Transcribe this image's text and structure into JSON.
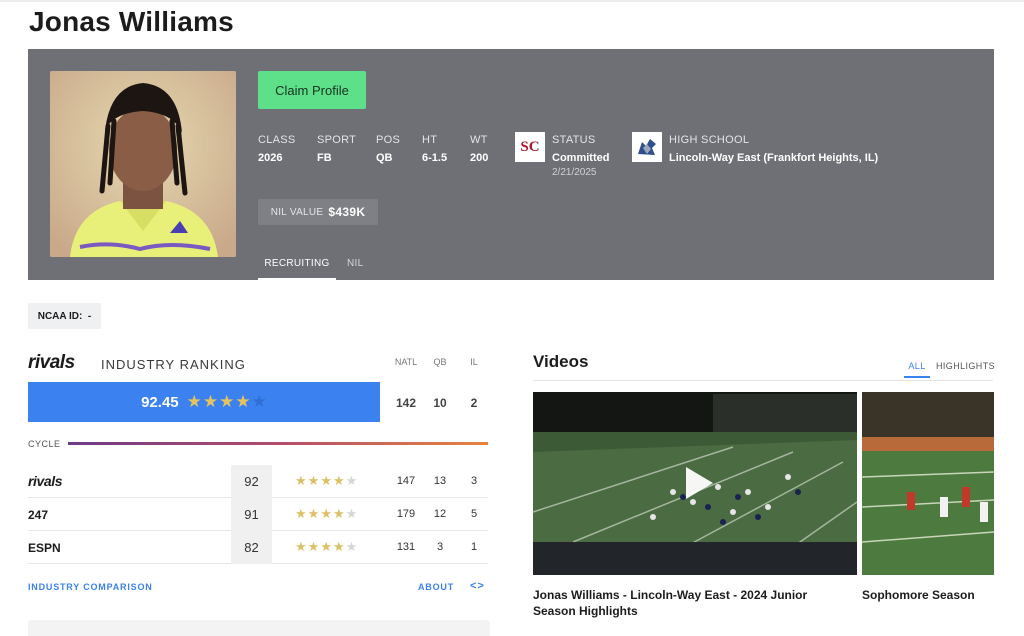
{
  "player": {
    "name": "Jonas Williams"
  },
  "profile": {
    "claim_label": "Claim Profile",
    "stats": [
      {
        "label": "CLASS",
        "value": "2026"
      },
      {
        "label": "SPORT",
        "value": "FB"
      },
      {
        "label": "POS",
        "value": "QB"
      },
      {
        "label": "HT",
        "value": "6-1.5"
      },
      {
        "label": "WT",
        "value": "200"
      }
    ],
    "status": {
      "label": "STATUS",
      "value": "Committed",
      "date": "2/21/2025",
      "logo_text": "SC"
    },
    "high_school": {
      "label": "HIGH SCHOOL",
      "value": "Lincoln-Way East (Frankfort Heights, IL)"
    },
    "nil": {
      "label": "NIL VALUE",
      "value": "$439K"
    },
    "tabs": [
      {
        "label": "RECRUITING"
      },
      {
        "label": "NIL"
      }
    ]
  },
  "ncaa": {
    "label": "NCAA ID:",
    "value": "-"
  },
  "ranking": {
    "brand": "rivals",
    "title": "INDUSTRY RANKING",
    "columns": [
      "NATL",
      "QB",
      "IL"
    ],
    "score": "92.45",
    "stars": 4,
    "max_stars": 5,
    "natl": "142",
    "pos": "10",
    "state": "2",
    "cycle_label": "CYCLE",
    "sources": [
      {
        "name": "rivals",
        "rating": "92",
        "stars": 4,
        "natl": "147",
        "pos": "13",
        "state": "3"
      },
      {
        "name": "247",
        "rating": "91",
        "stars": 4,
        "natl": "179",
        "pos": "12",
        "state": "5"
      },
      {
        "name": "ESPN",
        "rating": "82",
        "stars": 4,
        "natl": "131",
        "pos": "3",
        "state": "1"
      }
    ],
    "comparison_link": "INDUSTRY COMPARISON",
    "about_link": "ABOUT",
    "code_icon": "code-icon"
  },
  "videos": {
    "title": "Videos",
    "tabs": [
      {
        "label": "ALL"
      },
      {
        "label": "HIGHLIGHTS"
      }
    ],
    "items": [
      {
        "caption": "Jonas Williams - Lincoln-Way East - 2024 Junior Season Highlights",
        "icon": "play-icon"
      },
      {
        "caption": "Sophomore Season"
      }
    ]
  },
  "colors": {
    "accent": "#3b82f0",
    "claim": "#5ee08a",
    "hero_bg": "#6f7075",
    "star": "#e6c35c"
  }
}
